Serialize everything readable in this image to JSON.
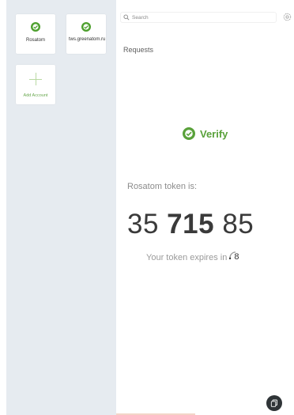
{
  "accounts": [
    {
      "label": "Rosatom",
      "icon": "authy-logo-icon"
    },
    {
      "label": "tws.greenatom.ru",
      "icon": "authy-logo-icon"
    }
  ],
  "add_account": {
    "label": "Add Account",
    "icon": "plus-icon"
  },
  "search": {
    "placeholder": "Search"
  },
  "requests": {
    "title": "Requests"
  },
  "verify": {
    "logo_text": "Verify"
  },
  "token": {
    "label": "Rosatom token is:",
    "part1": "35",
    "part2": "715",
    "part3": "85",
    "expires_text": "Your token expires in",
    "seconds": "8",
    "seconds_fraction": 0.27
  },
  "colors": {
    "accent": "#59a13a",
    "sidebar": "#e6ebf0",
    "fab": "#2f3437"
  }
}
